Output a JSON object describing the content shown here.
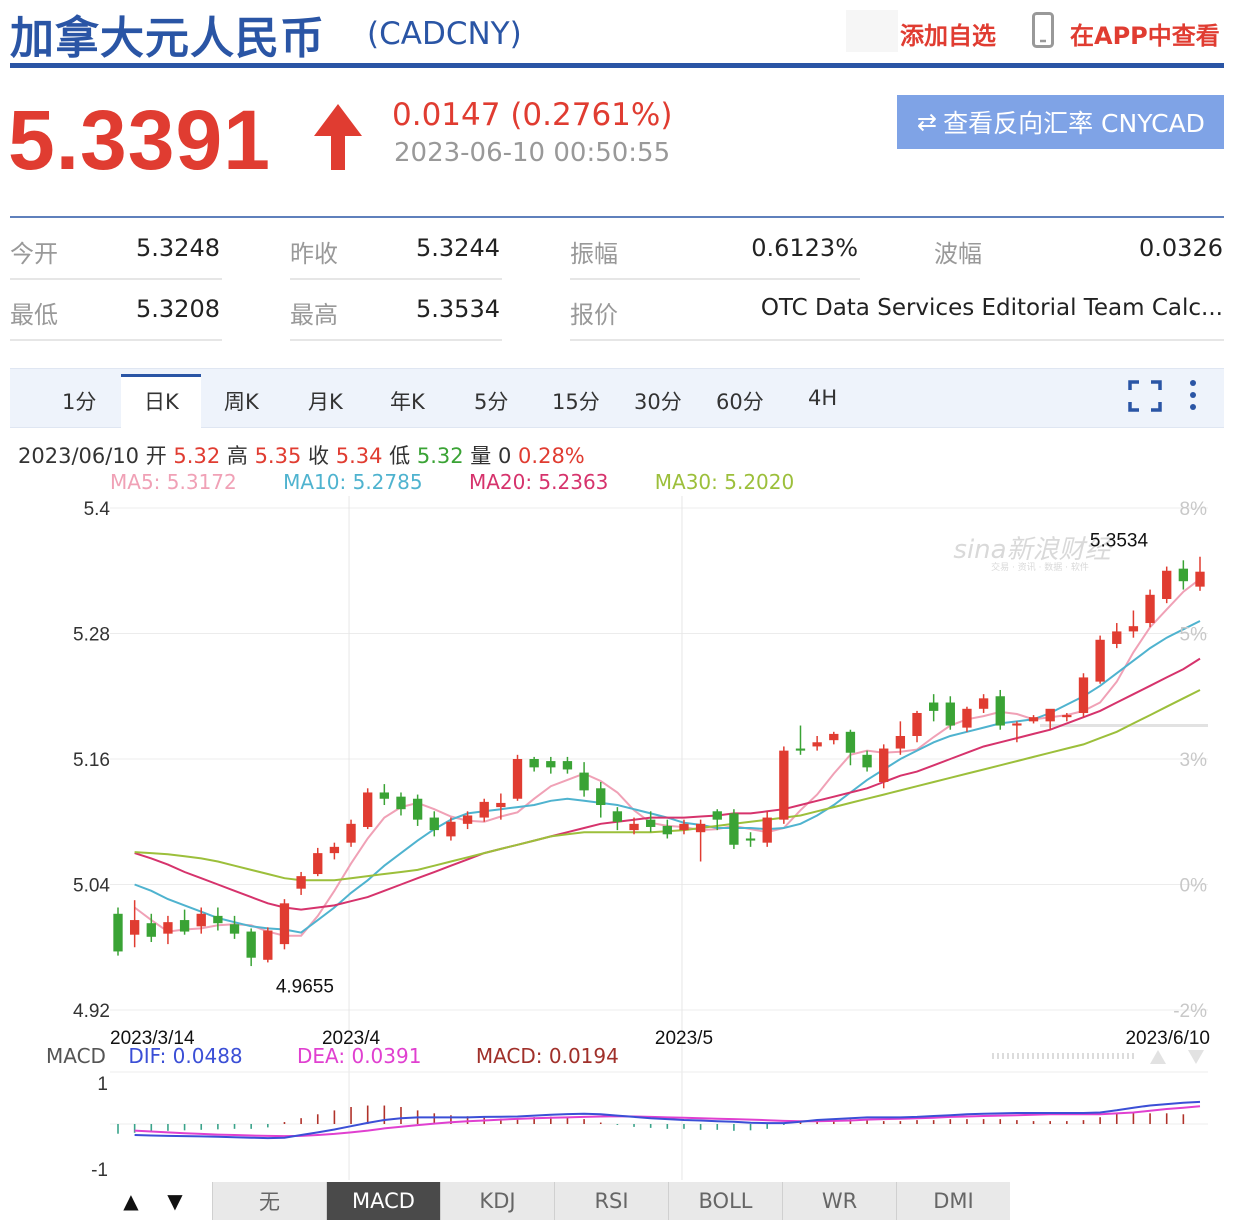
{
  "header": {
    "title": "加拿大元人民币",
    "symbol": "(CADCNY)",
    "add_watchlist": "添加自选",
    "view_in_app": "在APP中查看"
  },
  "quote": {
    "price": "5.3391",
    "change": "0.0147 (0.2761%)",
    "time": "2023-06-10 00:50:55",
    "reverse_button": "查看反向汇率 CNYCAD",
    "direction": "up",
    "up_color": "#e03c31",
    "down_color": "#3aa335"
  },
  "stats": [
    {
      "label": "今开",
      "value": "5.3248"
    },
    {
      "label": "昨收",
      "value": "5.3244"
    },
    {
      "label": "振幅",
      "value": "0.6123%"
    },
    {
      "label": "波幅",
      "value": "0.0326"
    },
    {
      "label": "最低",
      "value": "5.3208"
    },
    {
      "label": "最高",
      "value": "5.3534"
    },
    {
      "label": "报价",
      "value": "OTC Data Services Editorial Team Calc..."
    }
  ],
  "tabs": [
    "1分",
    "日K",
    "周K",
    "月K",
    "年K",
    "5分",
    "15分",
    "30分",
    "60分",
    "4H"
  ],
  "active_tab": "日K",
  "ohlc": {
    "date": "2023/06/10",
    "open_label": "开",
    "open": "5.32",
    "high_label": "高",
    "high": "5.35",
    "close_label": "收",
    "close": "5.34",
    "low_label": "低",
    "low": "5.32",
    "volume_label": "量",
    "volume": "0",
    "pct": "0.28%"
  },
  "ma": {
    "ma5": "MA5: 5.3172",
    "ma10": "MA10: 5.2785",
    "ma20": "MA20: 5.2363",
    "ma30": "MA30: 5.2020"
  },
  "macd": {
    "label": "MACD",
    "dif": "DIF: 0.0488",
    "dea": "DEA: 0.0391",
    "macd": "MACD: 0.0194"
  },
  "indicator_tabs": [
    "无",
    "MACD",
    "KDJ",
    "RSI",
    "BOLL",
    "WR",
    "DMI"
  ],
  "active_indicator": "MACD",
  "chart_data": {
    "type": "candlestick",
    "y_ticks_left": [
      "5.4",
      "5.28",
      "5.16",
      "5.04",
      "4.92"
    ],
    "y_ticks_right": [
      "8%",
      "5%",
      "3%",
      "0%",
      "-2%"
    ],
    "ylim": [
      4.92,
      5.4
    ],
    "x_labels": [
      "2023/3/14",
      "2023/4",
      "2023/5",
      "2023/6/10"
    ],
    "x_label_index": [
      0,
      14,
      34,
      62
    ],
    "min_annotation": {
      "text": "4.9655",
      "index": 9,
      "value": 4.9655
    },
    "max_annotation": {
      "text": "5.3534",
      "index": 62,
      "value": 5.3534
    },
    "watermark": "sina新浪财经",
    "watermark_sub": "交易 · 资讯 · 数据 · 软件",
    "candles": [
      {
        "o": 5.012,
        "h": 5.018,
        "l": 4.972,
        "c": 4.976
      },
      {
        "o": 4.992,
        "h": 5.025,
        "l": 4.98,
        "c": 5.006
      },
      {
        "o": 5.003,
        "h": 5.012,
        "l": 4.985,
        "c": 4.99
      },
      {
        "o": 4.993,
        "h": 5.01,
        "l": 4.983,
        "c": 5.004
      },
      {
        "o": 5.006,
        "h": 5.016,
        "l": 4.992,
        "c": 4.995
      },
      {
        "o": 5.0,
        "h": 5.018,
        "l": 4.993,
        "c": 5.012
      },
      {
        "o": 5.01,
        "h": 5.018,
        "l": 4.996,
        "c": 5.003
      },
      {
        "o": 5.002,
        "h": 5.01,
        "l": 4.988,
        "c": 4.993
      },
      {
        "o": 4.995,
        "h": 4.998,
        "l": 4.962,
        "c": 4.97
      },
      {
        "o": 4.968,
        "h": 4.999,
        "l": 4.9655,
        "c": 4.996
      },
      {
        "o": 4.983,
        "h": 5.026,
        "l": 4.978,
        "c": 5.022
      },
      {
        "o": 5.036,
        "h": 5.052,
        "l": 5.03,
        "c": 5.048
      },
      {
        "o": 5.05,
        "h": 5.075,
        "l": 5.048,
        "c": 5.07
      },
      {
        "o": 5.07,
        "h": 5.08,
        "l": 5.064,
        "c": 5.076
      },
      {
        "o": 5.08,
        "h": 5.102,
        "l": 5.076,
        "c": 5.098
      },
      {
        "o": 5.095,
        "h": 5.132,
        "l": 5.093,
        "c": 5.128
      },
      {
        "o": 5.128,
        "h": 5.136,
        "l": 5.116,
        "c": 5.122
      },
      {
        "o": 5.124,
        "h": 5.128,
        "l": 5.106,
        "c": 5.112
      },
      {
        "o": 5.122,
        "h": 5.126,
        "l": 5.096,
        "c": 5.102
      },
      {
        "o": 5.104,
        "h": 5.11,
        "l": 5.086,
        "c": 5.092
      },
      {
        "o": 5.086,
        "h": 5.104,
        "l": 5.082,
        "c": 5.1
      },
      {
        "o": 5.098,
        "h": 5.11,
        "l": 5.093,
        "c": 5.106
      },
      {
        "o": 5.104,
        "h": 5.122,
        "l": 5.1,
        "c": 5.119
      },
      {
        "o": 5.114,
        "h": 5.127,
        "l": 5.102,
        "c": 5.118
      },
      {
        "o": 5.122,
        "h": 5.164,
        "l": 5.12,
        "c": 5.16
      },
      {
        "o": 5.16,
        "h": 5.162,
        "l": 5.148,
        "c": 5.152
      },
      {
        "o": 5.158,
        "h": 5.162,
        "l": 5.146,
        "c": 5.152
      },
      {
        "o": 5.158,
        "h": 5.162,
        "l": 5.146,
        "c": 5.15
      },
      {
        "o": 5.147,
        "h": 5.157,
        "l": 5.124,
        "c": 5.13
      },
      {
        "o": 5.132,
        "h": 5.138,
        "l": 5.104,
        "c": 5.116
      },
      {
        "o": 5.11,
        "h": 5.114,
        "l": 5.092,
        "c": 5.1
      },
      {
        "o": 5.092,
        "h": 5.104,
        "l": 5.088,
        "c": 5.098
      },
      {
        "o": 5.102,
        "h": 5.11,
        "l": 5.09,
        "c": 5.095
      },
      {
        "o": 5.096,
        "h": 5.102,
        "l": 5.084,
        "c": 5.088
      },
      {
        "o": 5.092,
        "h": 5.102,
        "l": 5.088,
        "c": 5.098
      },
      {
        "o": 5.09,
        "h": 5.102,
        "l": 5.062,
        "c": 5.098
      },
      {
        "o": 5.11,
        "h": 5.112,
        "l": 5.092,
        "c": 5.102
      },
      {
        "o": 5.108,
        "h": 5.112,
        "l": 5.074,
        "c": 5.078
      },
      {
        "o": 5.084,
        "h": 5.09,
        "l": 5.076,
        "c": 5.082
      },
      {
        "o": 5.08,
        "h": 5.11,
        "l": 5.076,
        "c": 5.104
      },
      {
        "o": 5.102,
        "h": 5.172,
        "l": 5.098,
        "c": 5.168
      },
      {
        "o": 5.17,
        "h": 5.192,
        "l": 5.164,
        "c": 5.168
      },
      {
        "o": 5.172,
        "h": 5.182,
        "l": 5.168,
        "c": 5.176
      },
      {
        "o": 5.178,
        "h": 5.186,
        "l": 5.174,
        "c": 5.184
      },
      {
        "o": 5.186,
        "h": 5.188,
        "l": 5.154,
        "c": 5.166
      },
      {
        "o": 5.164,
        "h": 5.168,
        "l": 5.148,
        "c": 5.152
      },
      {
        "o": 5.138,
        "h": 5.174,
        "l": 5.132,
        "c": 5.17
      },
      {
        "o": 5.17,
        "h": 5.196,
        "l": 5.164,
        "c": 5.182
      },
      {
        "o": 5.182,
        "h": 5.206,
        "l": 5.176,
        "c": 5.204
      },
      {
        "o": 5.214,
        "h": 5.222,
        "l": 5.196,
        "c": 5.206
      },
      {
        "o": 5.214,
        "h": 5.22,
        "l": 5.188,
        "c": 5.192
      },
      {
        "o": 5.19,
        "h": 5.21,
        "l": 5.186,
        "c": 5.208
      },
      {
        "o": 5.208,
        "h": 5.222,
        "l": 5.204,
        "c": 5.218
      },
      {
        "o": 5.22,
        "h": 5.226,
        "l": 5.188,
        "c": 5.192
      },
      {
        "o": 5.192,
        "h": 5.196,
        "l": 5.176,
        "c": 5.194
      },
      {
        "o": 5.196,
        "h": 5.202,
        "l": 5.194,
        "c": 5.2
      },
      {
        "o": 5.196,
        "h": 5.202,
        "l": 5.188,
        "c": 5.208
      },
      {
        "o": 5.2,
        "h": 5.204,
        "l": 5.196,
        "c": 5.202
      },
      {
        "o": 5.204,
        "h": 5.242,
        "l": 5.2,
        "c": 5.238
      },
      {
        "o": 5.234,
        "h": 5.278,
        "l": 5.232,
        "c": 5.274
      },
      {
        "o": 5.27,
        "h": 5.29,
        "l": 5.266,
        "c": 5.282
      },
      {
        "o": 5.282,
        "h": 5.302,
        "l": 5.276,
        "c": 5.287
      },
      {
        "o": 5.29,
        "h": 5.322,
        "l": 5.286,
        "c": 5.317
      },
      {
        "o": 5.313,
        "h": 5.344,
        "l": 5.309,
        "c": 5.34
      },
      {
        "o": 5.342,
        "h": 5.35,
        "l": 5.322,
        "c": 5.33
      },
      {
        "o": 5.3248,
        "h": 5.3534,
        "l": 5.3208,
        "c": 5.3391
      }
    ],
    "ma_lines": [
      {
        "name": "MA5",
        "color": "#f0a1b6",
        "values": [
          5.018,
          5.006,
          4.995,
          4.997,
          4.998,
          5.001,
          5.002,
          5.001,
          4.995,
          4.991,
          4.991,
          5.01,
          5.034,
          5.06,
          5.084,
          5.104,
          5.114,
          5.118,
          5.112,
          5.105,
          5.101,
          5.1,
          5.105,
          5.109,
          5.122,
          5.134,
          5.14,
          5.146,
          5.139,
          5.128,
          5.111,
          5.099,
          5.096,
          5.095,
          5.092,
          5.093,
          5.096,
          5.093,
          5.09,
          5.094,
          5.111,
          5.126,
          5.146,
          5.164,
          5.168,
          5.166,
          5.167,
          5.169,
          5.181,
          5.192,
          5.198,
          5.201,
          5.205,
          5.203,
          5.198,
          5.2,
          5.202,
          5.206,
          5.214,
          5.234,
          5.262,
          5.286,
          5.303,
          5.32,
          5.332
        ]
      },
      {
        "name": "MA10",
        "color": "#4fb3cf",
        "values": [
          5.04,
          5.034,
          5.026,
          5.02,
          5.014,
          5.008,
          5.004,
          5.0,
          4.998,
          4.997,
          4.994,
          5.006,
          5.018,
          5.032,
          5.044,
          5.058,
          5.07,
          5.082,
          5.093,
          5.102,
          5.108,
          5.11,
          5.112,
          5.114,
          5.116,
          5.12,
          5.122,
          5.12,
          5.118,
          5.116,
          5.112,
          5.108,
          5.104,
          5.099,
          5.097,
          5.094,
          5.094,
          5.094,
          5.093,
          5.094,
          5.098,
          5.106,
          5.116,
          5.128,
          5.14,
          5.15,
          5.16,
          5.168,
          5.176,
          5.182,
          5.186,
          5.19,
          5.194,
          5.196,
          5.198,
          5.204,
          5.212,
          5.22,
          5.23,
          5.242,
          5.254,
          5.266,
          5.276,
          5.284,
          5.292
        ]
      },
      {
        "name": "MA20",
        "color": "#d6336c",
        "values": [
          5.07,
          5.065,
          5.059,
          5.052,
          5.046,
          5.04,
          5.034,
          5.028,
          5.022,
          5.018,
          5.016,
          5.018,
          5.02,
          5.024,
          5.028,
          5.034,
          5.04,
          5.046,
          5.052,
          5.058,
          5.064,
          5.07,
          5.074,
          5.078,
          5.082,
          5.086,
          5.09,
          5.094,
          5.098,
          5.1,
          5.102,
          5.104,
          5.104,
          5.104,
          5.105,
          5.106,
          5.108,
          5.108,
          5.11,
          5.112,
          5.116,
          5.12,
          5.124,
          5.128,
          5.132,
          5.138,
          5.144,
          5.148,
          5.154,
          5.16,
          5.166,
          5.172,
          5.176,
          5.18,
          5.184,
          5.188,
          5.194,
          5.2,
          5.206,
          5.214,
          5.222,
          5.23,
          5.238,
          5.246,
          5.256
        ]
      },
      {
        "name": "MA30",
        "color": "#9cbf3b",
        "values": [
          5.071,
          5.07,
          5.069,
          5.067,
          5.065,
          5.062,
          5.058,
          5.054,
          5.05,
          5.046,
          5.044,
          5.044,
          5.044,
          5.046,
          5.048,
          5.05,
          5.052,
          5.054,
          5.058,
          5.062,
          5.066,
          5.07,
          5.074,
          5.078,
          5.082,
          5.086,
          5.088,
          5.09,
          5.09,
          5.09,
          5.09,
          5.09,
          5.091,
          5.092,
          5.094,
          5.096,
          5.098,
          5.1,
          5.102,
          5.104,
          5.106,
          5.11,
          5.114,
          5.118,
          5.122,
          5.126,
          5.13,
          5.134,
          5.138,
          5.142,
          5.146,
          5.15,
          5.154,
          5.158,
          5.162,
          5.166,
          5.17,
          5.174,
          5.18,
          5.186,
          5.194,
          5.202,
          5.21,
          5.218,
          5.226
        ]
      }
    ],
    "macd_panel": {
      "y_ticks": [
        "1",
        "-1"
      ],
      "ylim": [
        -1.2,
        1.2
      ],
      "dif": {
        "name": "DIF",
        "color": "#3b4fd6",
        "values": [
          -0.5,
          -0.52,
          -0.54,
          -0.55,
          -0.56,
          -0.58,
          -0.6,
          -0.62,
          -0.64,
          -0.62,
          -0.5,
          -0.38,
          -0.25,
          -0.1,
          0.05,
          0.18,
          0.26,
          0.3,
          0.3,
          0.3,
          0.3,
          0.32,
          0.33,
          0.34,
          0.38,
          0.42,
          0.45,
          0.46,
          0.44,
          0.38,
          0.32,
          0.26,
          0.22,
          0.18,
          0.16,
          0.12,
          0.1,
          0.06,
          0.04,
          0.04,
          0.1,
          0.18,
          0.22,
          0.26,
          0.3,
          0.3,
          0.3,
          0.32,
          0.36,
          0.4,
          0.44,
          0.46,
          0.48,
          0.5,
          0.5,
          0.5,
          0.5,
          0.5,
          0.52,
          0.62,
          0.74,
          0.84,
          0.9,
          0.96,
          1.0
        ]
      },
      "dea": {
        "name": "DEA",
        "color": "#e040d0",
        "values": [
          -0.3,
          -0.34,
          -0.38,
          -0.42,
          -0.45,
          -0.48,
          -0.5,
          -0.52,
          -0.54,
          -0.55,
          -0.54,
          -0.5,
          -0.45,
          -0.38,
          -0.3,
          -0.2,
          -0.12,
          -0.05,
          0.02,
          0.08,
          0.12,
          0.16,
          0.2,
          0.23,
          0.26,
          0.28,
          0.3,
          0.32,
          0.34,
          0.35,
          0.34,
          0.32,
          0.3,
          0.28,
          0.26,
          0.24,
          0.22,
          0.2,
          0.17,
          0.14,
          0.12,
          0.12,
          0.14,
          0.16,
          0.2,
          0.22,
          0.24,
          0.26,
          0.28,
          0.32,
          0.34,
          0.36,
          0.38,
          0.4,
          0.42,
          0.44,
          0.44,
          0.44,
          0.44,
          0.48,
          0.52,
          0.6,
          0.68,
          0.74,
          0.8
        ]
      },
      "hist": [
        -0.4,
        -0.36,
        -0.32,
        -0.28,
        -0.26,
        -0.24,
        -0.22,
        -0.2,
        -0.2,
        -0.14,
        0.08,
        0.24,
        0.4,
        0.56,
        0.7,
        0.76,
        0.76,
        0.7,
        0.56,
        0.44,
        0.36,
        0.32,
        0.26,
        0.22,
        0.24,
        0.28,
        0.3,
        0.28,
        0.2,
        0.06,
        -0.04,
        -0.12,
        -0.16,
        -0.2,
        -0.2,
        -0.24,
        -0.24,
        -0.28,
        -0.26,
        -0.2,
        -0.04,
        0.12,
        0.16,
        0.2,
        0.2,
        0.16,
        0.12,
        0.12,
        0.16,
        0.16,
        0.2,
        0.2,
        0.2,
        0.2,
        0.16,
        0.12,
        0.12,
        0.12,
        0.16,
        0.28,
        0.44,
        0.48,
        0.44,
        0.44,
        0.4
      ]
    }
  }
}
